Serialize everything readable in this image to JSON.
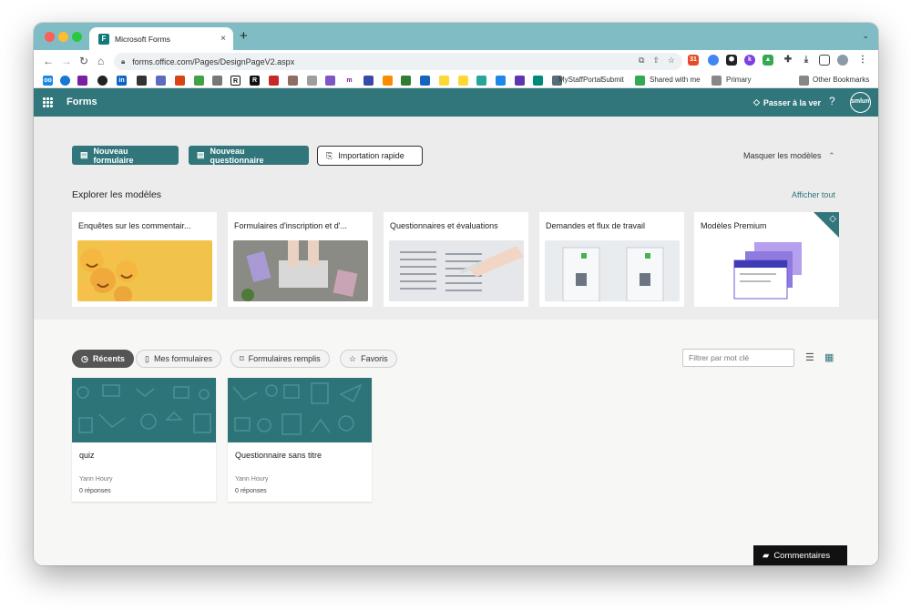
{
  "browser": {
    "tab_title": "Microsoft Forms",
    "tab_close": "×",
    "new_tab": "+",
    "url": "forms.office.com/Pages/DesignPageV2.aspx",
    "bookmarks": [
      {
        "label": "MyStaffPortal"
      },
      {
        "label": "Submit"
      },
      {
        "label": "Shared with me"
      },
      {
        "label": "Primary"
      },
      {
        "label": "Other Bookmarks"
      }
    ]
  },
  "app": {
    "name": "Forms",
    "upgrade": "Passer à la ver",
    "help": "?",
    "avatar": "smlum"
  },
  "actions": {
    "new_form": "Nouveau formulaire",
    "new_quiz": "Nouveau questionnaire",
    "quick_import": "Importation rapide",
    "hide_models": "Masquer les modèles"
  },
  "templates": {
    "title": "Explorer les modèles",
    "see_all": "Afficher tout",
    "cards": [
      {
        "title": "Enquêtes sur les commentair..."
      },
      {
        "title": "Formulaires d'inscription et d'..."
      },
      {
        "title": "Questionnaires et évaluations"
      },
      {
        "title": "Demandes et flux de travail"
      },
      {
        "title": "Modèles Premium"
      }
    ]
  },
  "recent": {
    "tabs": [
      {
        "label": "Récents",
        "active": true
      },
      {
        "label": "Mes formulaires",
        "active": false
      },
      {
        "label": "Formulaires remplis",
        "active": false
      },
      {
        "label": "Favoris",
        "active": false
      }
    ],
    "filter_placeholder": "Filtrer par mot clé",
    "forms": [
      {
        "title": "quiz",
        "owner": "Yann Houry",
        "responses": "0 réponses"
      },
      {
        "title": "Questionnaire sans titre",
        "owner": "Yann Houry",
        "responses": "0 réponses"
      }
    ]
  },
  "feedback": "Commentaires",
  "colors": {
    "brand": "#31767b",
    "tabbar": "#7fbcc4"
  }
}
